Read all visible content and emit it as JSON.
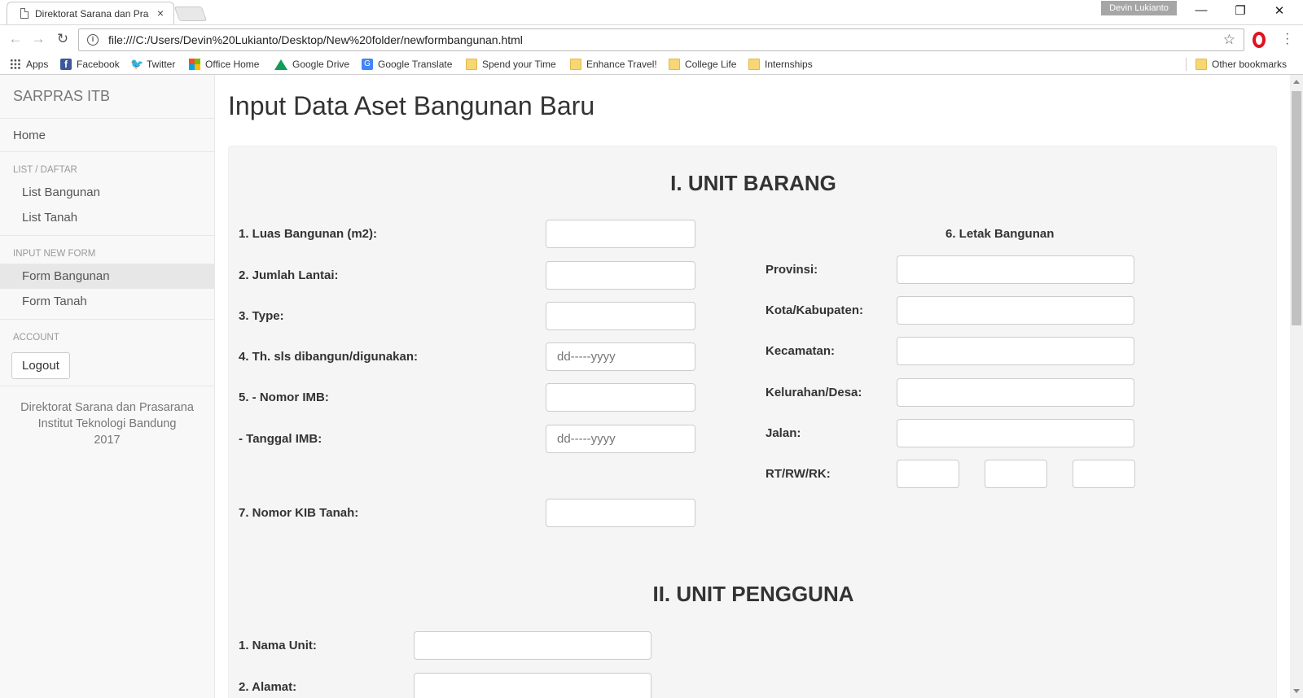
{
  "browser": {
    "tab_title": "Direktorat Sarana dan Prasarana",
    "tab_close": "×",
    "profile_name": "Devin Lukianto",
    "url": "file:///C:/Users/Devin%20Lukianto/Desktop/New%20folder/newformbangunan.html",
    "window_controls": {
      "minimize": "—",
      "restore": "❐",
      "close": "✕"
    },
    "bookmarks": [
      {
        "label": "Apps",
        "icon": "apps-grid-icon"
      },
      {
        "label": "Facebook",
        "icon": "facebook-icon"
      },
      {
        "label": "Twitter",
        "icon": "twitter-icon"
      },
      {
        "label": "Office Home",
        "icon": "office-icon"
      },
      {
        "label": "Google Drive",
        "icon": "google-drive-icon"
      },
      {
        "label": "Google Translate",
        "icon": "google-translate-icon"
      },
      {
        "label": "Spend your Time",
        "icon": "folder-icon"
      },
      {
        "label": "Enhance Travel!",
        "icon": "folder-icon"
      },
      {
        "label": "College Life",
        "icon": "folder-icon"
      },
      {
        "label": "Internships",
        "icon": "folder-icon"
      }
    ],
    "other_bookmarks": "Other bookmarks"
  },
  "sidebar": {
    "brand": "SARPRAS ITB",
    "home": "Home",
    "list_header": "LIST / DAFTAR",
    "list_items": [
      "List Bangunan",
      "List Tanah"
    ],
    "input_header": "INPUT NEW FORM",
    "input_items": [
      "Form Bangunan",
      "Form Tanah"
    ],
    "active_item": "Form Bangunan",
    "account_header": "ACCOUNT",
    "logout": "Logout",
    "footer": {
      "line1": "Direktorat Sarana dan Prasarana",
      "line2": "Institut Teknologi Bandung",
      "line3": "2017"
    }
  },
  "main": {
    "page_title": "Input Data Aset Bangunan Baru",
    "section1_title": "I. UNIT BARANG",
    "fields_left": [
      {
        "label": "1. Luas Bangunan (m2):",
        "value": ""
      },
      {
        "label": "2. Jumlah Lantai:",
        "value": ""
      },
      {
        "label": "3. Type:",
        "value": ""
      },
      {
        "label": "4. Th. sls dibangun/digunakan:",
        "placeholder": "dd-----yyyy"
      },
      {
        "label": "5. - Nomor IMB:",
        "value": ""
      },
      {
        "label": "- Tanggal IMB:",
        "placeholder": "dd-----yyyy"
      },
      {
        "label": "7. Nomor KIB Tanah:",
        "value": ""
      }
    ],
    "letak_title": "6. Letak Bangunan",
    "fields_right": [
      {
        "label": "Provinsi:",
        "value": ""
      },
      {
        "label": "Kota/Kabupaten:",
        "value": ""
      },
      {
        "label": "Kecamatan:",
        "value": ""
      },
      {
        "label": "Kelurahan/Desa:",
        "value": ""
      },
      {
        "label": "Jalan:",
        "value": ""
      },
      {
        "label": "RT/RW/RK:",
        "value": ""
      }
    ],
    "section2_title": "II. UNIT PENGGUNA",
    "fields_section2": [
      {
        "label": "1. Nama Unit:",
        "value": ""
      },
      {
        "label": "2. Alamat:",
        "value": ""
      }
    ]
  }
}
